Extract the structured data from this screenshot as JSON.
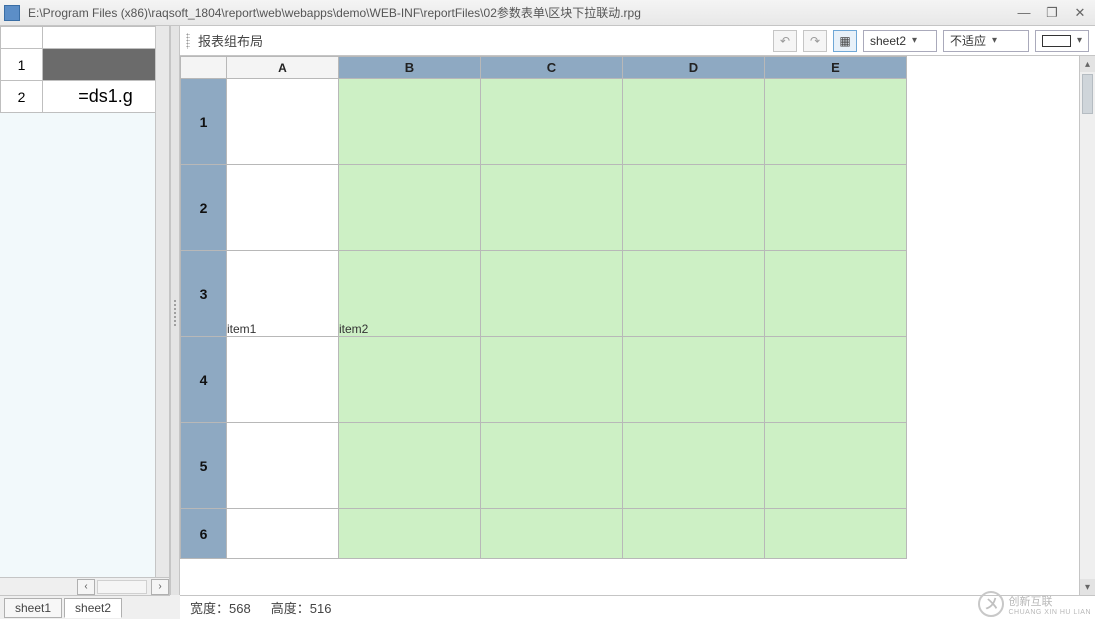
{
  "window": {
    "title": "E:\\Program Files (x86)\\raqsoft_1804\\report\\web\\webapps\\demo\\WEB-INF\\reportFiles\\02参数表单\\区块下拉联动.rpg",
    "minimize_icon": "—",
    "maximize_icon": "❐",
    "close_icon": "✕"
  },
  "left_panel": {
    "cols": [
      ""
    ],
    "rows": [
      {
        "num": "1",
        "value": ""
      },
      {
        "num": "2",
        "value": "=ds1.g"
      }
    ],
    "scroll_left": "‹",
    "scroll_right": "›"
  },
  "toolbar": {
    "label": "报表组布局",
    "btn_undo": "↶",
    "btn_redo": "↷",
    "btn_layout": "▦",
    "sheet_select": "sheet2",
    "fit_select": "不适应",
    "color_swatch_icon": ""
  },
  "grid": {
    "columns": [
      "A",
      "B",
      "C",
      "D",
      "E"
    ],
    "rows": [
      "1",
      "2",
      "3",
      "4",
      "5",
      "6"
    ],
    "label_item1": "item1",
    "label_item2": "item2"
  },
  "tabs": {
    "sheet1": "sheet1",
    "sheet2": "sheet2"
  },
  "status": {
    "width_label": "宽度：",
    "width_value": "568",
    "height_label": "高度：",
    "height_value": "516"
  },
  "watermark": {
    "cn": "创新互联",
    "en": "CHUANG XIN HU LIAN",
    "logo_text": "〤"
  }
}
